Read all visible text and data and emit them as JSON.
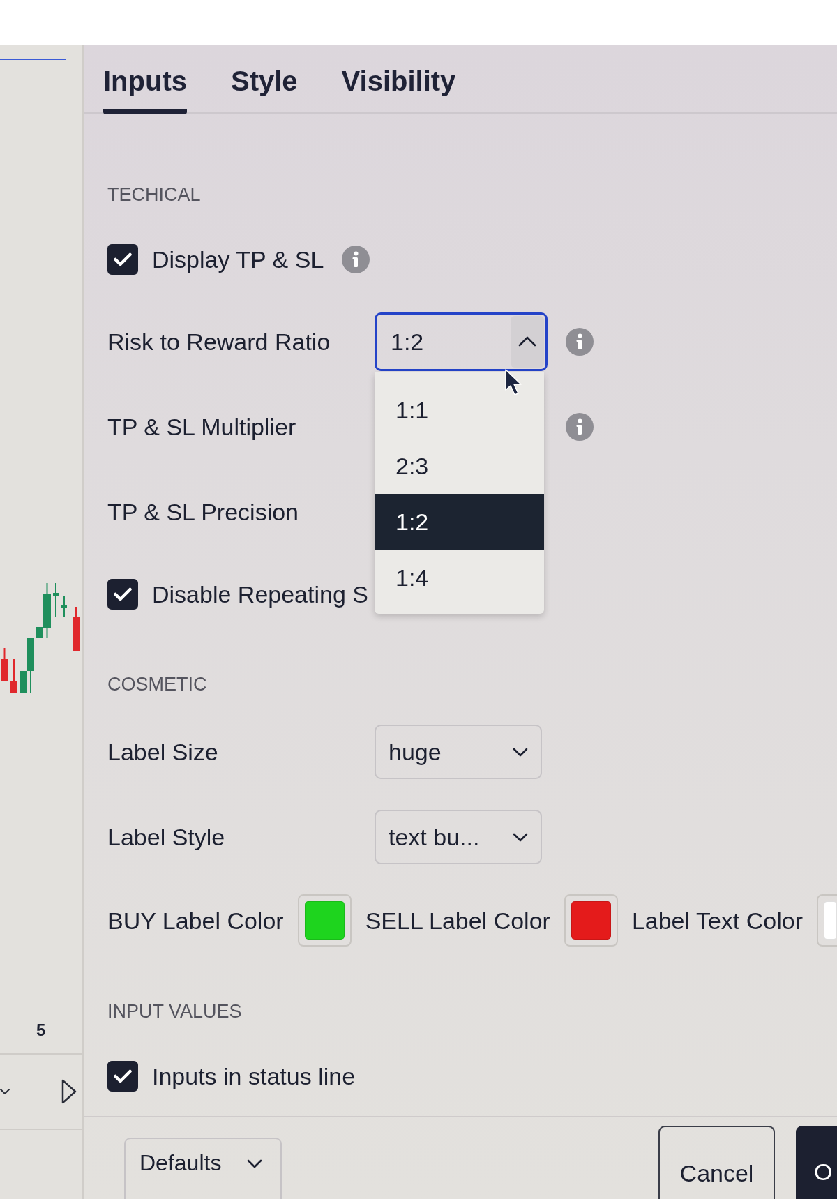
{
  "tabs": [
    {
      "label": "Inputs",
      "selected": true
    },
    {
      "label": "Style",
      "selected": false
    },
    {
      "label": "Visibility",
      "selected": false
    }
  ],
  "sections": [
    {
      "title": "TECHICAL",
      "items": [
        {
          "kind": "checkbox",
          "label": "Display TP & SL",
          "checked": true,
          "info": true
        },
        {
          "kind": "select",
          "label": "Risk to Reward Ratio",
          "value": "1:2",
          "expanded": true,
          "info": true,
          "options": [
            {
              "label": "1:1",
              "selected": false
            },
            {
              "label": "2:3",
              "selected": false
            },
            {
              "label": "1:2",
              "selected": true
            },
            {
              "label": "1:4",
              "selected": false
            }
          ]
        },
        {
          "kind": "label",
          "label": "TP & SL Multiplier",
          "info": true
        },
        {
          "kind": "label",
          "label": "TP & SL Precision"
        },
        {
          "kind": "checkbox",
          "label": "Disable Repeating S",
          "checked": true
        }
      ]
    },
    {
      "title": "COSMETIC",
      "items": [
        {
          "kind": "select",
          "label": "Label Size",
          "value": "huge",
          "expanded": false
        },
        {
          "kind": "select",
          "label": "Label Style",
          "value": "text bu...",
          "expanded": false
        },
        {
          "kind": "colors",
          "swatches": [
            {
              "label": "BUY Label Color",
              "color": "#1ed41e"
            },
            {
              "label": "SELL Label Color",
              "color": "#e41b1b"
            },
            {
              "label": "Label Text Color",
              "color": "#ffffff"
            }
          ]
        }
      ]
    },
    {
      "title": "INPUT VALUES",
      "items": [
        {
          "kind": "checkbox",
          "label": "Inputs in status line",
          "checked": true
        }
      ]
    }
  ],
  "footer": {
    "defaults": "Defaults",
    "cancel": "Cancel",
    "ok": "O"
  },
  "sidebar": {
    "scale_label": "5"
  }
}
